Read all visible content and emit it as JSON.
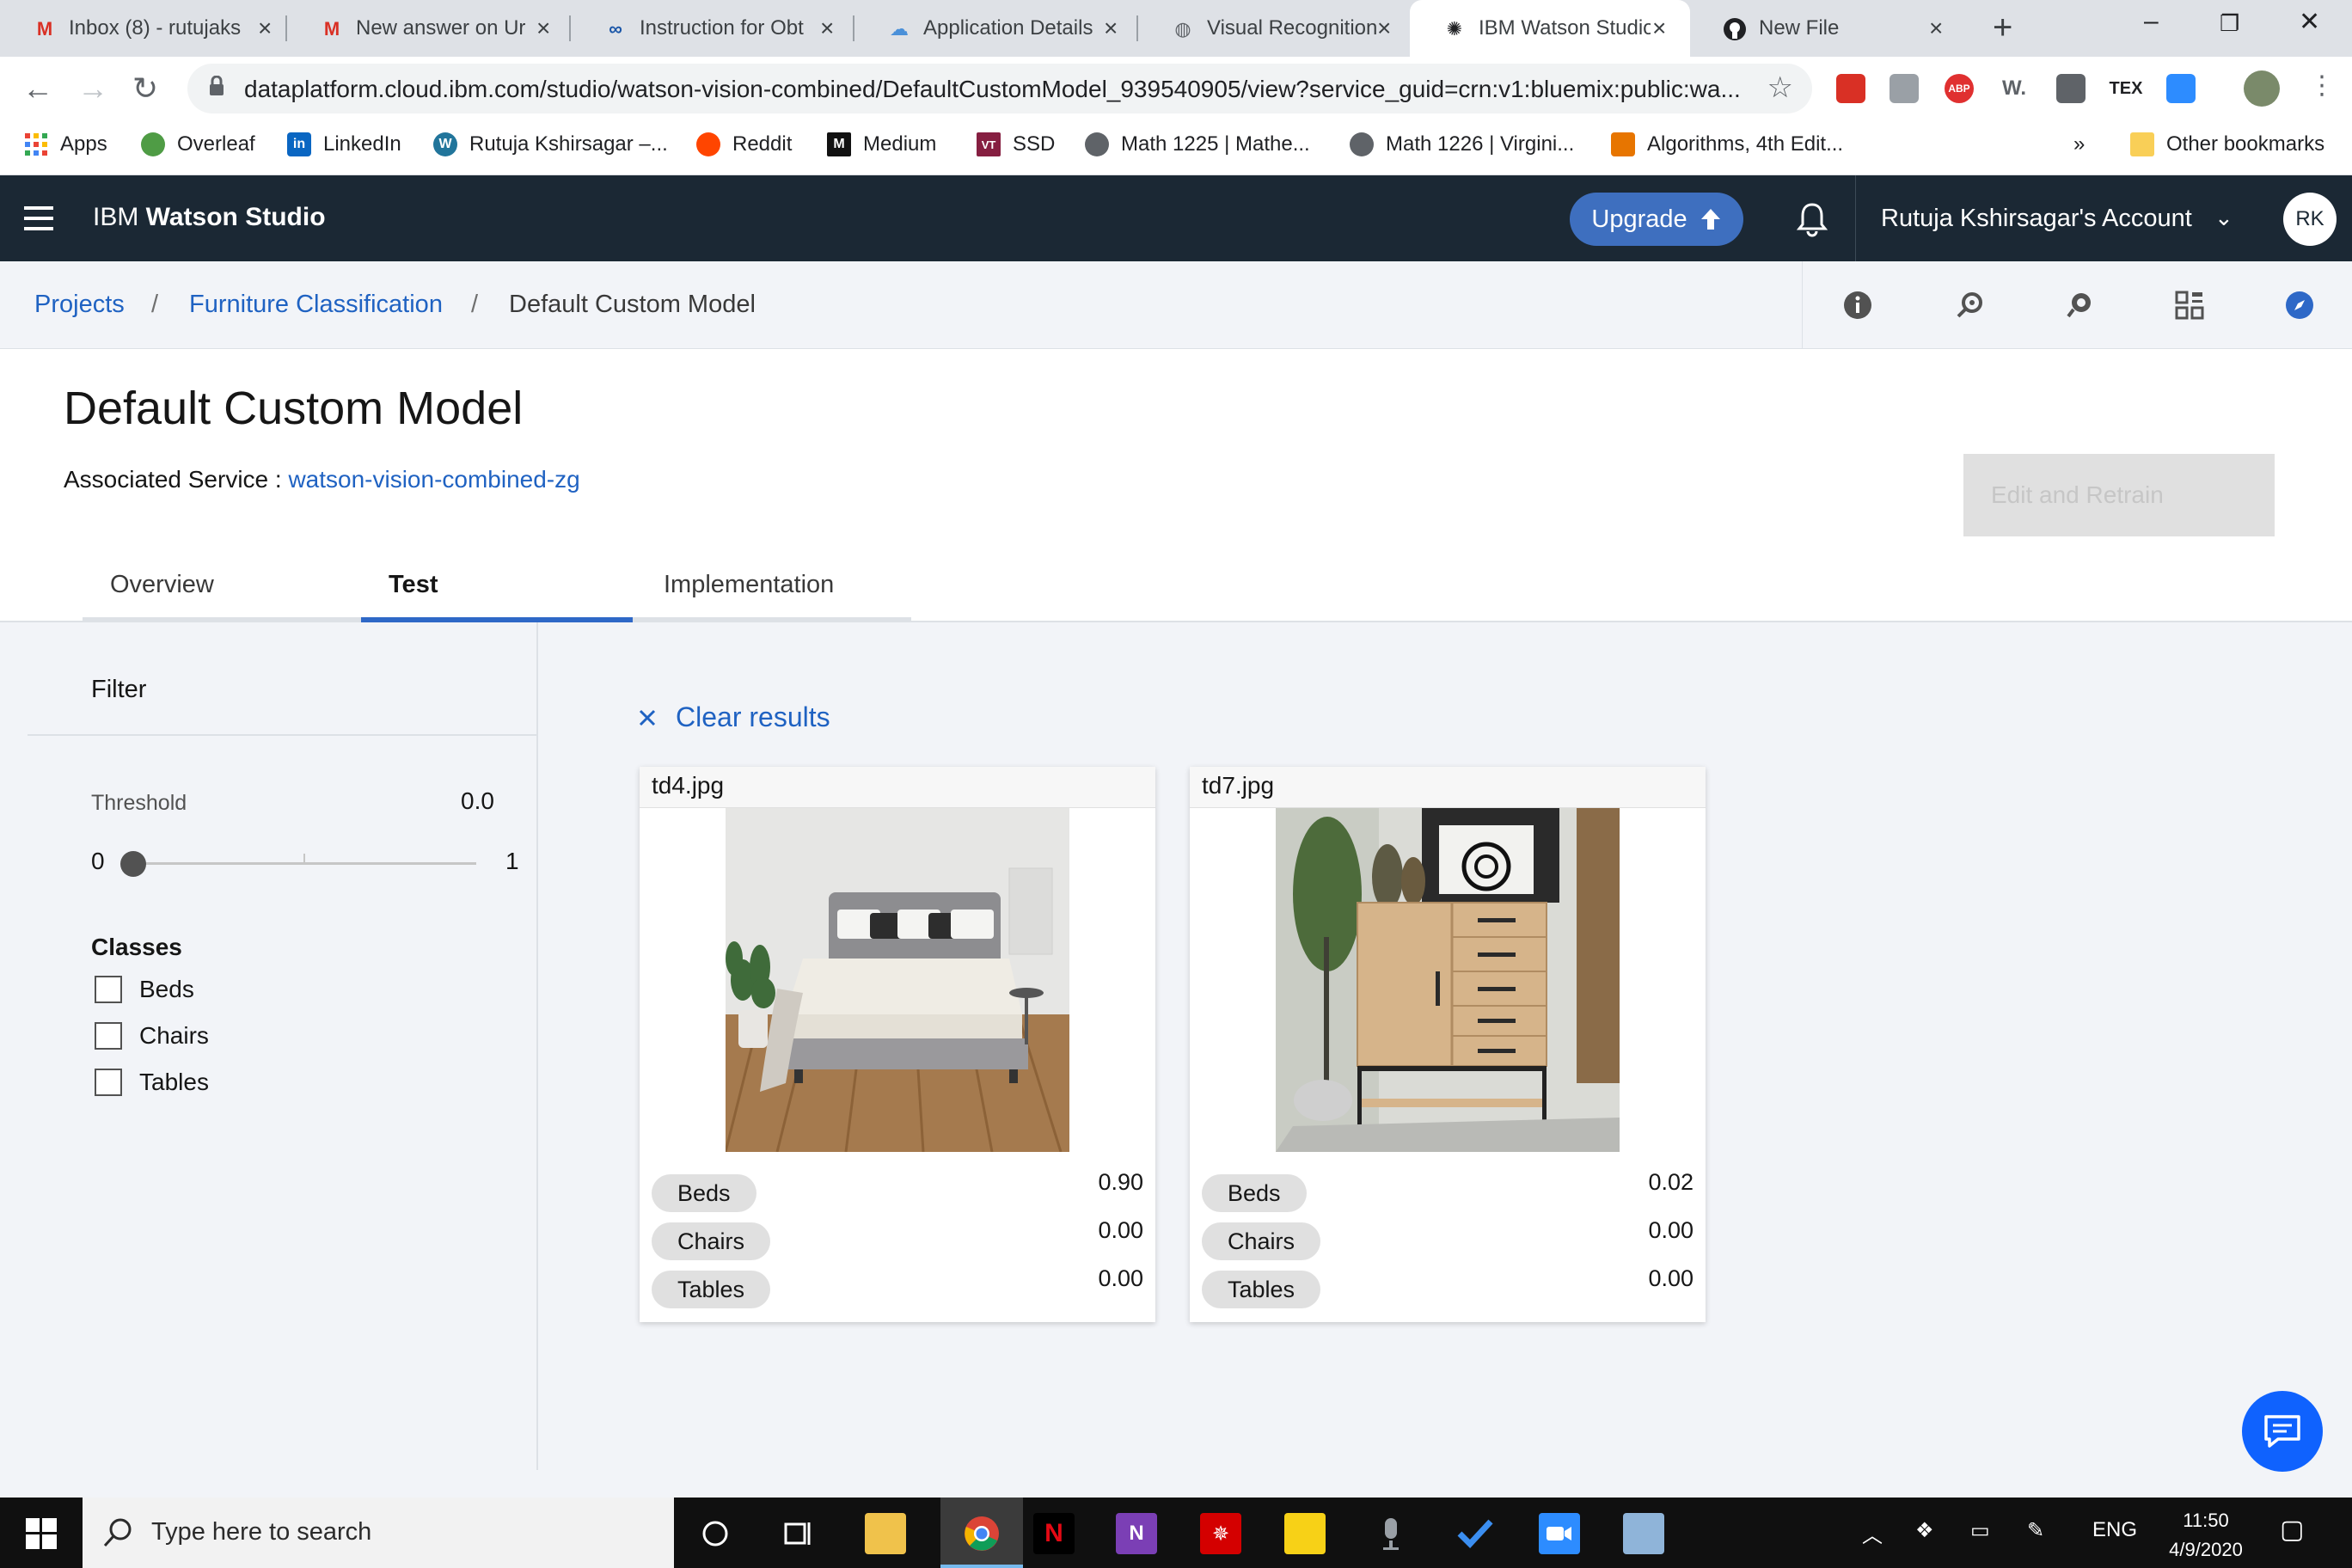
{
  "browser": {
    "tabs": [
      {
        "title": "Inbox (8) - rutujaks",
        "icon": "gmail-icon"
      },
      {
        "title": "New answer on Ur",
        "icon": "gmail-icon"
      },
      {
        "title": "Instruction for Obt",
        "icon": "link-icon"
      },
      {
        "title": "Application Details",
        "icon": "cloud-icon"
      },
      {
        "title": "Visual Recognition",
        "icon": "globe-icon"
      },
      {
        "title": "IBM Watson Studio",
        "icon": "watson-icon"
      },
      {
        "title": "New File",
        "icon": "github-icon"
      }
    ],
    "url": "dataplatform.cloud.ibm.com/studio/watson-vision-combined/DefaultCustomModel_939540905/view?service_guid=crn:v1:bluemix:public:wa...",
    "bookmarks": [
      {
        "label": "Apps",
        "icon": "apps-grid-icon"
      },
      {
        "label": "Overleaf",
        "icon": "overleaf-icon"
      },
      {
        "label": "LinkedIn",
        "icon": "linkedin-icon"
      },
      {
        "label": "Rutuja Kshirsagar –...",
        "icon": "wordpress-icon"
      },
      {
        "label": "Reddit",
        "icon": "reddit-icon"
      },
      {
        "label": "Medium",
        "icon": "medium-icon"
      },
      {
        "label": "SSD",
        "icon": "vt-icon"
      },
      {
        "label": "Math 1225 | Mathe...",
        "icon": "globe-icon"
      },
      {
        "label": "Math 1226 | Virgini...",
        "icon": "globe-icon"
      },
      {
        "label": "Algorithms, 4th Edit...",
        "icon": "princeton-icon"
      }
    ],
    "more_bookmarks": "»",
    "other_bookmarks": "Other bookmarks"
  },
  "header": {
    "brand_prefix": "IBM ",
    "brand_bold": "Watson Studio",
    "upgrade_label": "Upgrade",
    "account_label": "Rutuja Kshirsagar's Account",
    "avatar_initials": "RK"
  },
  "breadcrumb": {
    "items": [
      "Projects",
      "Furniture Classification",
      "Default Custom Model"
    ],
    "separator": "/"
  },
  "page": {
    "title": "Default Custom Model",
    "associated_label": "Associated Service : ",
    "associated_service": "watson-vision-combined-zg",
    "retrain_label": "Edit and Retrain",
    "tabs": [
      "Overview",
      "Test",
      "Implementation"
    ],
    "active_tab": "Test"
  },
  "filter": {
    "title": "Filter",
    "threshold_label": "Threshold",
    "threshold_value": "0.0",
    "slider_min": "0",
    "slider_max": "1",
    "slider_level": 0.0,
    "classes_title": "Classes",
    "classes": [
      "Beds",
      "Chairs",
      "Tables"
    ]
  },
  "results": {
    "clear_label": "Clear results",
    "cards": [
      {
        "filename": "td4.jpg",
        "image": "bed-photo",
        "scores": [
          {
            "class": "Beds",
            "score": "0.90"
          },
          {
            "class": "Chairs",
            "score": "0.00"
          },
          {
            "class": "Tables",
            "score": "0.00"
          }
        ]
      },
      {
        "filename": "td7.jpg",
        "image": "cabinet-photo",
        "scores": [
          {
            "class": "Beds",
            "score": "0.02"
          },
          {
            "class": "Chairs",
            "score": "0.00"
          },
          {
            "class": "Tables",
            "score": "0.00"
          }
        ]
      }
    ]
  },
  "taskbar": {
    "search_placeholder": "Type here to search",
    "language": "ENG",
    "time": "11:50",
    "date": "4/9/2020"
  },
  "colors": {
    "header_bg": "#1b2834",
    "link": "#1f62c2",
    "upgrade": "#3e6fbf",
    "active_tab_line": "#2e68c7",
    "chat_fab": "#0f62fe"
  }
}
